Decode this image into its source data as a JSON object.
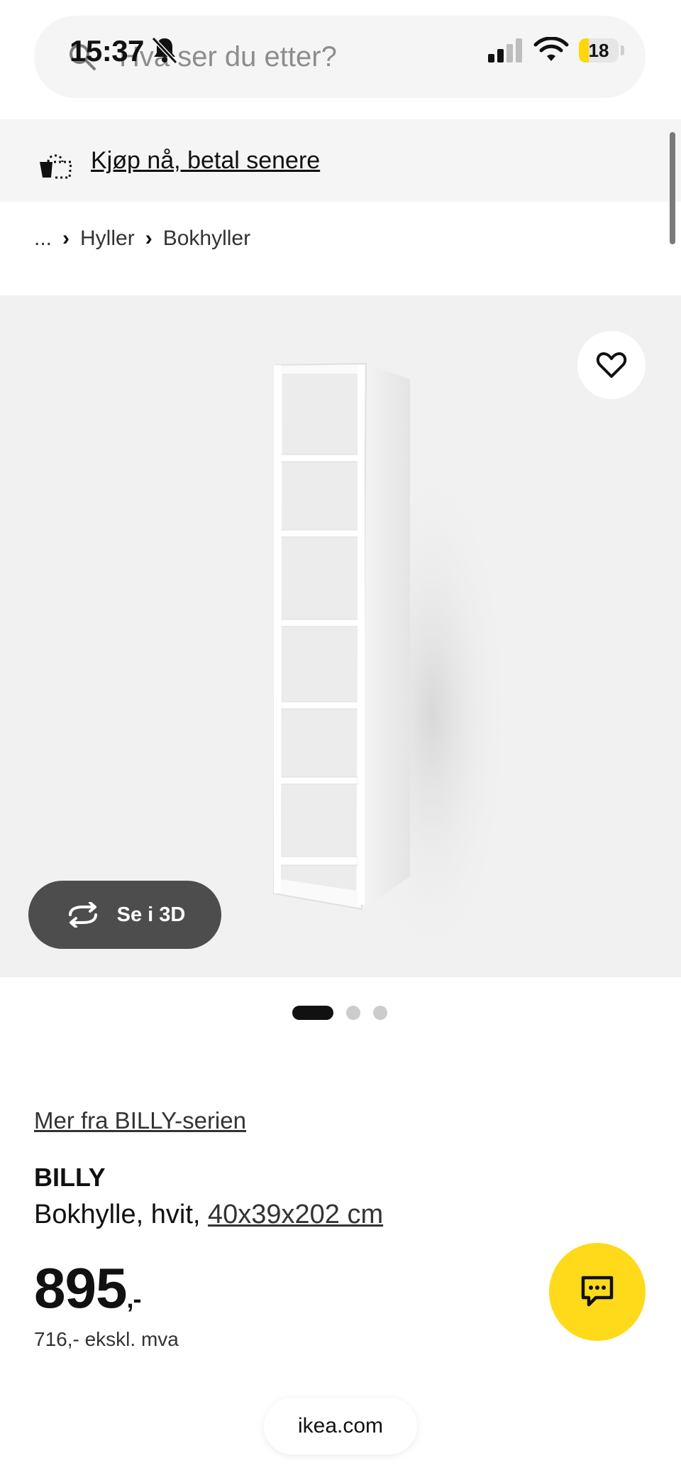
{
  "status_bar": {
    "time": "15:37",
    "battery": "18"
  },
  "search": {
    "placeholder": "Hva ser du etter?"
  },
  "banner": {
    "bnpl_label": "Kjøp nå, betal senere"
  },
  "breadcrumb": {
    "ellipsis": "...",
    "items": [
      "Hyller",
      "Bokhyller"
    ]
  },
  "gallery": {
    "view3d_label": "Se i 3D",
    "dots_count": 3,
    "active_index": 0
  },
  "product": {
    "series_link": "Mer fra BILLY-serien",
    "name": "BILLY",
    "description": "Bokhylle, hvit, ",
    "size": "40x39x202 cm",
    "price": "895",
    "price_suffix": ",-",
    "price_ex_vat": "716,- ekskl. mva"
  },
  "browser": {
    "url": "ikea.com"
  },
  "colors": {
    "accent_yellow": "#ffda1a",
    "dark_button": "#4d4d4d",
    "banner_bg": "#f5f5f5"
  },
  "icons": {
    "search": "search-icon",
    "bell": "bell-slash-icon",
    "favorite": "heart-icon",
    "view3d": "rotate-icon",
    "chat": "chat-bubble-icon",
    "bnpl": "shopping-bag-icon"
  }
}
